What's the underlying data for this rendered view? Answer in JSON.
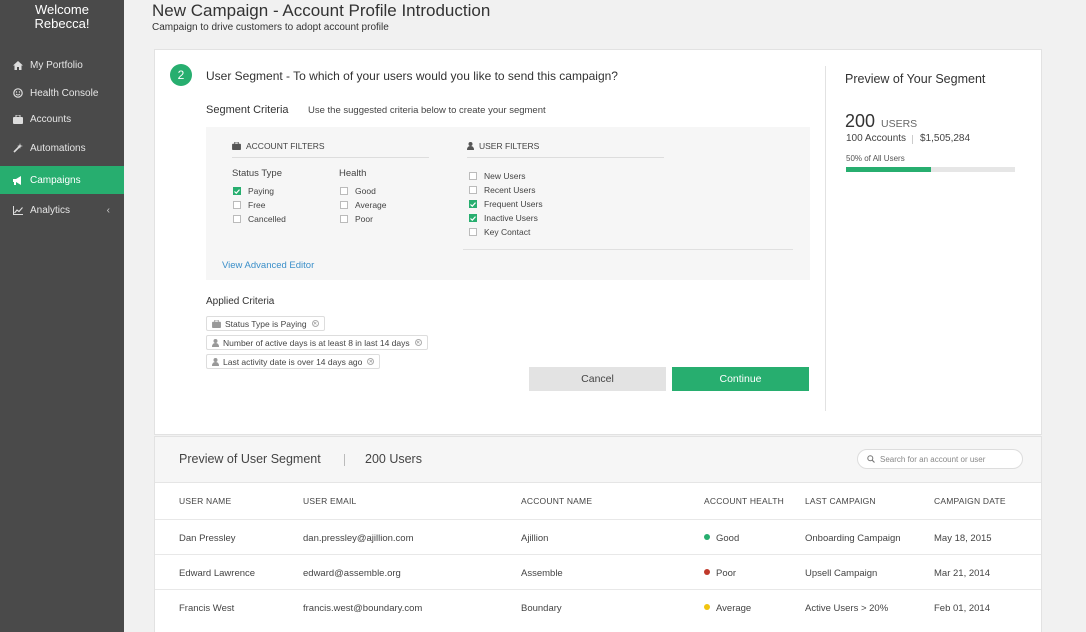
{
  "sidebar": {
    "welcome_line1": "Welcome",
    "welcome_line2": "Rebecca!",
    "items": [
      {
        "label": "My Portfolio",
        "icon": "home-icon"
      },
      {
        "label": "Health Console",
        "icon": "smile-icon"
      },
      {
        "label": "Accounts",
        "icon": "briefcase-icon"
      },
      {
        "label": "Automations",
        "icon": "wand-icon"
      },
      {
        "label": "Campaigns",
        "icon": "megaphone-icon",
        "active": true
      },
      {
        "label": "Analytics",
        "icon": "chart-icon",
        "chevron": "‹"
      }
    ]
  },
  "header": {
    "title": "New Campaign - Account Profile Introduction",
    "subtitle": "Campaign to drive customers to adopt account profile"
  },
  "step": {
    "number": "2",
    "question": "User Segment - To which of your users would you like to send this campaign?"
  },
  "segment_criteria": {
    "label": "Segment Criteria",
    "hint": "Use the suggested criteria below to create your segment"
  },
  "account_filters": {
    "heading": "ACCOUNT FILTERS",
    "status_type": {
      "title": "Status Type",
      "options": [
        {
          "label": "Paying",
          "checked": true
        },
        {
          "label": "Free",
          "checked": false
        },
        {
          "label": "Cancelled",
          "checked": false
        }
      ]
    },
    "health": {
      "title": "Health",
      "options": [
        {
          "label": "Good",
          "checked": false
        },
        {
          "label": "Average",
          "checked": false
        },
        {
          "label": "Poor",
          "checked": false
        }
      ]
    }
  },
  "user_filters": {
    "heading": "USER FILTERS",
    "options": [
      {
        "label": "New Users",
        "checked": false
      },
      {
        "label": "Recent Users",
        "checked": false
      },
      {
        "label": "Frequent Users",
        "checked": true
      },
      {
        "label": "Inactive Users",
        "checked": true
      },
      {
        "label": "Key Contact",
        "checked": false
      }
    ]
  },
  "advanced_editor_link": "View Advanced Editor",
  "applied_criteria": {
    "label": "Applied Criteria",
    "chips": [
      {
        "label": "Status Type is Paying",
        "icon": "briefcase-icon"
      },
      {
        "label": "Number of active days is at least 8 in last 14 days",
        "icon": "user-icon"
      },
      {
        "label": "Last activity date is over 14 days ago",
        "icon": "user-icon"
      }
    ]
  },
  "buttons": {
    "cancel": "Cancel",
    "continue": "Continue"
  },
  "preview": {
    "title": "Preview of Your Segment",
    "count": "200",
    "count_unit": "USERS",
    "accounts": "100 Accounts",
    "amount": "$1,505,284",
    "percent_label": "50% of All Users",
    "percent_value": 0.5
  },
  "table": {
    "title": "Preview of User Segment",
    "count": "200 Users",
    "search_placeholder": "Search for an account or user",
    "columns": [
      "USER NAME",
      "USER EMAIL",
      "ACCOUNT NAME",
      "ACCOUNT HEALTH",
      "LAST CAMPAIGN",
      "CAMPAIGN DATE"
    ],
    "rows": [
      {
        "name": "Dan Pressley",
        "email": "dan.pressley@ajillion.com",
        "account": "Ajillion",
        "health": "Good",
        "health_color": "#27ae6f",
        "campaign": "Onboarding Campaign",
        "date": "May 18, 2015"
      },
      {
        "name": "Edward Lawrence",
        "email": "edward@assemble.org",
        "account": "Assemble",
        "health": "Poor",
        "health_color": "#c0392b",
        "campaign": "Upsell Campaign",
        "date": "Mar 21, 2014"
      },
      {
        "name": "Francis West",
        "email": "francis.west@boundary.com",
        "account": "Boundary",
        "health": "Average",
        "health_color": "#f1c40f",
        "campaign": "Active Users > 20%",
        "date": "Feb 01, 2014"
      }
    ]
  },
  "colors": {
    "accent": "#27ae6f",
    "sidebar_bg": "#4a4a4a",
    "link": "#3b8fc9"
  }
}
